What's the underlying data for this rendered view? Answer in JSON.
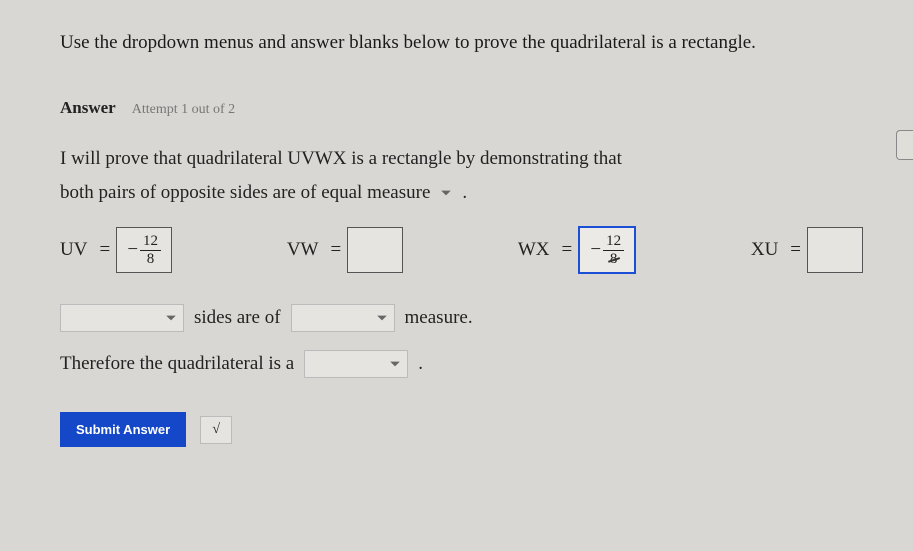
{
  "prompt": "Use the dropdown menus and answer blanks below to prove the quadrilateral is a rectangle.",
  "answer": {
    "label": "Answer",
    "attempt": "Attempt 1 out of 2"
  },
  "proof": {
    "line1": "I will prove that quadrilateral UVWX is a rectangle by demonstrating that",
    "line2": "both pairs of opposite sides are of equal measure",
    "period": "."
  },
  "segments": {
    "uv": {
      "label": "UV",
      "eq": "=",
      "sign": "−",
      "num": "12",
      "den": "8"
    },
    "vw": {
      "label": "VW",
      "eq": "="
    },
    "wx": {
      "label": "WX",
      "eq": "=",
      "sign": "−",
      "num": "12",
      "den": "8"
    },
    "xu": {
      "label": "XU",
      "eq": "="
    }
  },
  "sentence": {
    "mid": "sides are of",
    "end": "measure."
  },
  "therefore": {
    "text": "Therefore the quadrilateral is a",
    "period": "."
  },
  "submit": {
    "label": "Submit Answer",
    "sqrt": "√"
  }
}
